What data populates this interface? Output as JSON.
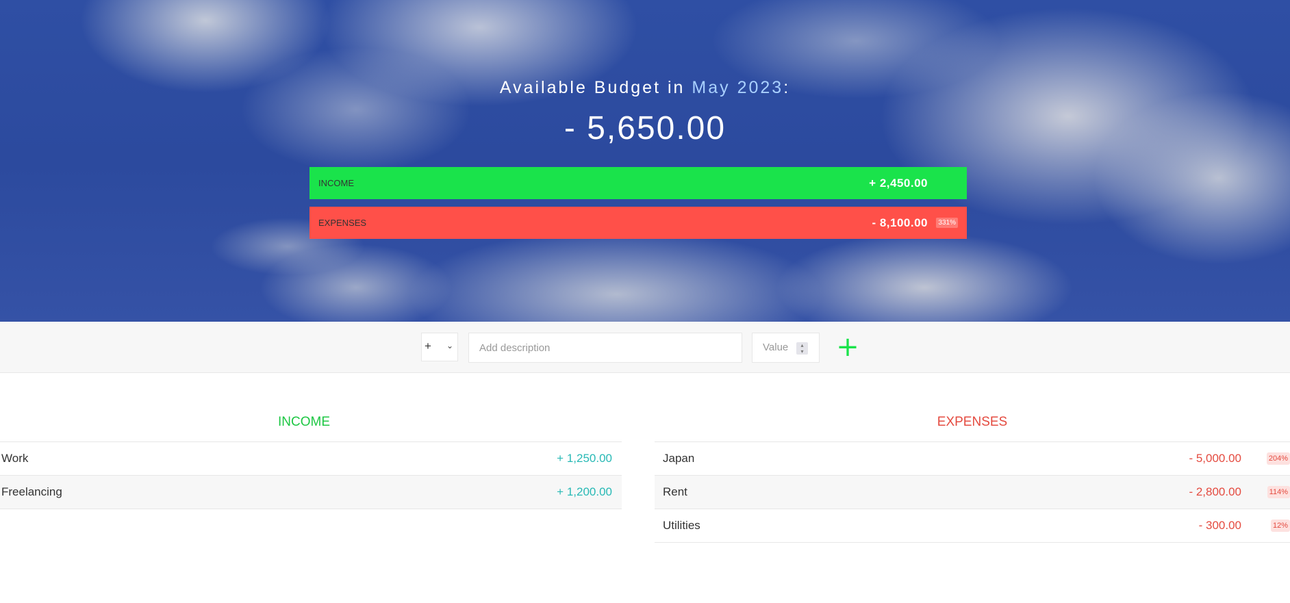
{
  "header": {
    "title_prefix": "Available Budget in ",
    "month": "May 2023",
    "title_suffix": ":",
    "budget_value": "- 5,650.00"
  },
  "summary": {
    "income": {
      "label": "Income",
      "value": "+ 2,450.00"
    },
    "expenses": {
      "label": "Expenses",
      "value": "- 8,100.00",
      "percentage": "331%"
    }
  },
  "add_form": {
    "type_value": "+",
    "description_placeholder": "Add description",
    "value_placeholder": "Value"
  },
  "income": {
    "title": "Income",
    "items": [
      {
        "description": "Work",
        "value": "+ 1,250.00"
      },
      {
        "description": "Freelancing",
        "value": "+ 1,200.00"
      }
    ]
  },
  "expenses": {
    "title": "Expenses",
    "items": [
      {
        "description": "Japan",
        "value": "- 5,000.00",
        "percentage": "204%"
      },
      {
        "description": "Rent",
        "value": "- 2,800.00",
        "percentage": "114%"
      },
      {
        "description": "Utilities",
        "value": "- 300.00",
        "percentage": "12%"
      }
    ]
  },
  "colors": {
    "income_bar": "#1ae34b",
    "expenses_bar": "#ff5049",
    "income_text": "#28b9b5",
    "expenses_text": "#e44b40",
    "month_accent": "#a9d0ff"
  }
}
